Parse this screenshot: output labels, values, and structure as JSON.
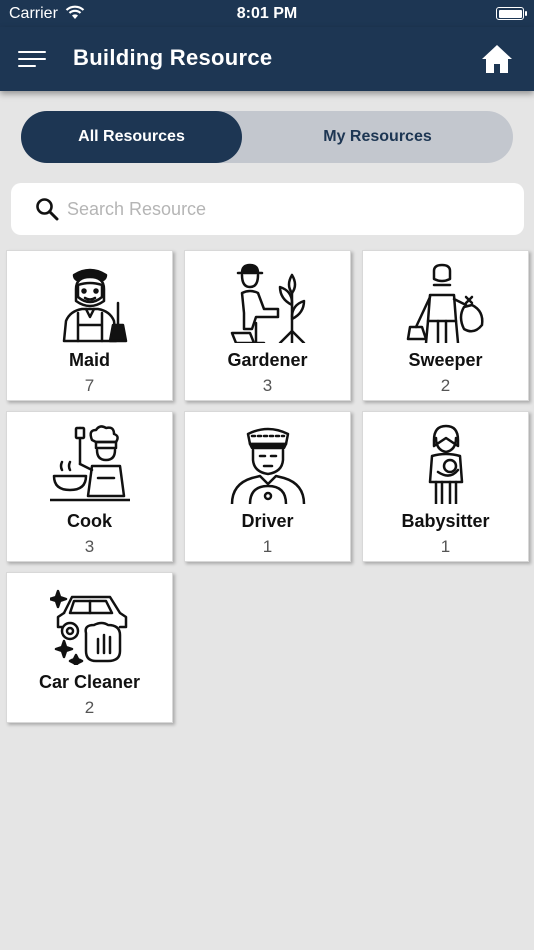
{
  "status_bar": {
    "carrier": "Carrier",
    "time": "8:01 PM"
  },
  "header": {
    "title": "Building Resource",
    "menu_icon": "menu-icon",
    "home_icon": "home-icon"
  },
  "tabs": {
    "all_label": "All Resources",
    "mine_label": "My Resources",
    "selected": "All Resources"
  },
  "search": {
    "placeholder": "Search Resource",
    "value": ""
  },
  "colors": {
    "primary": "#1d3653",
    "segment_bg": "#c3c7ce",
    "page_bg": "#e5e5e5"
  },
  "resources": [
    {
      "name": "Maid",
      "count": "7",
      "icon": "maid-icon"
    },
    {
      "name": "Gardener",
      "count": "3",
      "icon": "gardener-icon"
    },
    {
      "name": "Sweeper",
      "count": "2",
      "icon": "sweeper-icon"
    },
    {
      "name": "Cook",
      "count": "3",
      "icon": "cook-icon"
    },
    {
      "name": "Driver",
      "count": "1",
      "icon": "driver-icon"
    },
    {
      "name": "Babysitter",
      "count": "1",
      "icon": "babysitter-icon"
    },
    {
      "name": "Car Cleaner",
      "count": "2",
      "icon": "car-cleaner-icon"
    }
  ]
}
